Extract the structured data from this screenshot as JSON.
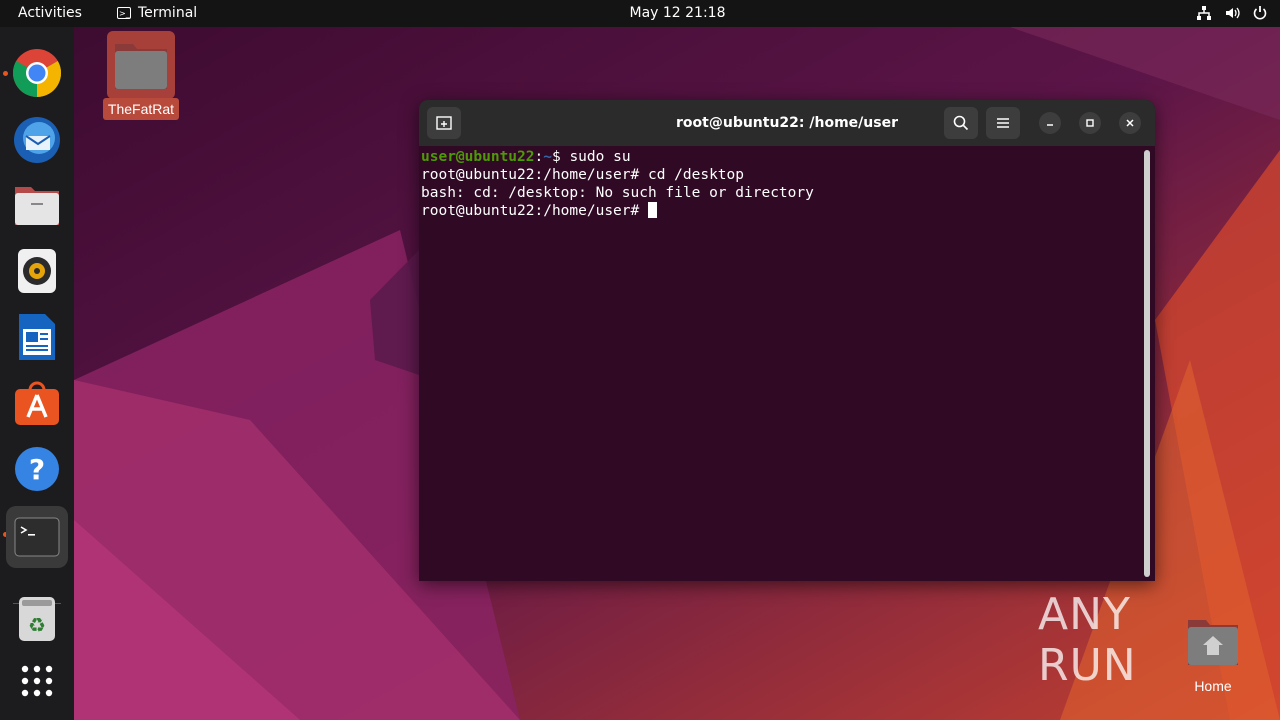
{
  "topbar": {
    "activities": "Activities",
    "app_name": "Terminal",
    "clock": "May 12  21:18",
    "tray_icons": [
      "network-icon",
      "volume-icon",
      "power-icon"
    ]
  },
  "dock": {
    "items": [
      {
        "name": "chrome",
        "running": true
      },
      {
        "name": "thunderbird",
        "running": false
      },
      {
        "name": "files",
        "running": false
      },
      {
        "name": "rhythmbox",
        "running": false
      },
      {
        "name": "libreoffice-writer",
        "running": false
      },
      {
        "name": "ubuntu-software",
        "running": false
      },
      {
        "name": "help",
        "running": false
      },
      {
        "name": "terminal",
        "running": true,
        "active": true
      },
      {
        "name": "trash",
        "running": false
      },
      {
        "name": "show-apps",
        "running": false
      }
    ]
  },
  "desktop": {
    "folder_label": "TheFatRat",
    "home_label": "Home"
  },
  "terminal": {
    "title": "root@ubuntu22: /home/user",
    "lines": [
      {
        "user_host": "user@ubuntu22",
        "sep": ":",
        "path": "~",
        "prompt": "$ ",
        "command": "sudo su"
      },
      {
        "text": "root@ubuntu22:/home/user# cd /desktop"
      },
      {
        "text": "bash: cd: /desktop: No such file or directory"
      },
      {
        "text": "root@ubuntu22:/home/user# "
      }
    ]
  },
  "watermark": "ANY RUN",
  "colors": {
    "accent": "#e95420",
    "terminal_bg": "#300a24",
    "prompt_green": "#4e9a06",
    "prompt_blue": "#3465a4"
  }
}
